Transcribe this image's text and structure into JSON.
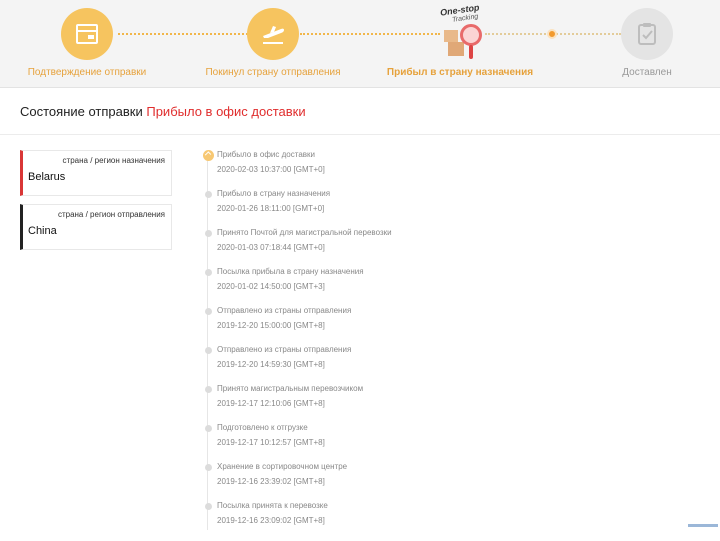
{
  "progress": {
    "steps": [
      {
        "label": "Подтверждение отправки",
        "icon": "package-icon",
        "state": "done"
      },
      {
        "label": "Покинул страну отправления",
        "icon": "plane-departure-icon",
        "state": "done"
      },
      {
        "label": "Прибыл в страну назначения",
        "icon": "one-stop-tracking-logo",
        "state": "current"
      },
      {
        "label": "Доставлен",
        "icon": "clipboard-check-icon",
        "state": "pending"
      }
    ],
    "logo_text_1": "One-stop",
    "logo_text_2": "Tracking"
  },
  "status": {
    "label": "Состояние отправки",
    "value": "Прибыло в офис доставки"
  },
  "destination": {
    "caption": "страна / регион назначения",
    "value": "Belarus"
  },
  "origin": {
    "caption": "страна / регион отправления",
    "value": "China"
  },
  "events": [
    {
      "desc": "Прибыло в офис доставки",
      "time": "2020-02-03 10:37:00 [GMT+0]"
    },
    {
      "desc": "Прибыло в страну назначения",
      "time": "2020-01-26 18:11:00 [GMT+0]"
    },
    {
      "desc": "Принято Почтой для магистральной перевозки",
      "time": "2020-01-03 07:18:44 [GMT+0]"
    },
    {
      "desc": "Посылка прибыла в страну назначения",
      "time": "2020-01-02 14:50:00 [GMT+3]"
    },
    {
      "desc": "Отправлено из страны отправления",
      "time": "2019-12-20 15:00:00 [GMT+8]"
    },
    {
      "desc": "Отправлено из страны отправления",
      "time": "2019-12-20 14:59:30 [GMT+8]"
    },
    {
      "desc": "Принято магистральным перевозчиком",
      "time": "2019-12-17 12:10:06 [GMT+8]"
    },
    {
      "desc": "Подготовлено к отгрузке",
      "time": "2019-12-17 10:12:57 [GMT+8]"
    },
    {
      "desc": "Хранение в сортировочном центре",
      "time": "2019-12-16 23:39:02 [GMT+8]"
    },
    {
      "desc": "Посылка принята к перевозке",
      "time": "2019-12-16 23:09:02 [GMT+8]"
    }
  ],
  "colors": {
    "accent": "#f6c45f",
    "accent_text": "#e6a23c",
    "status_red": "#e02d2d"
  }
}
